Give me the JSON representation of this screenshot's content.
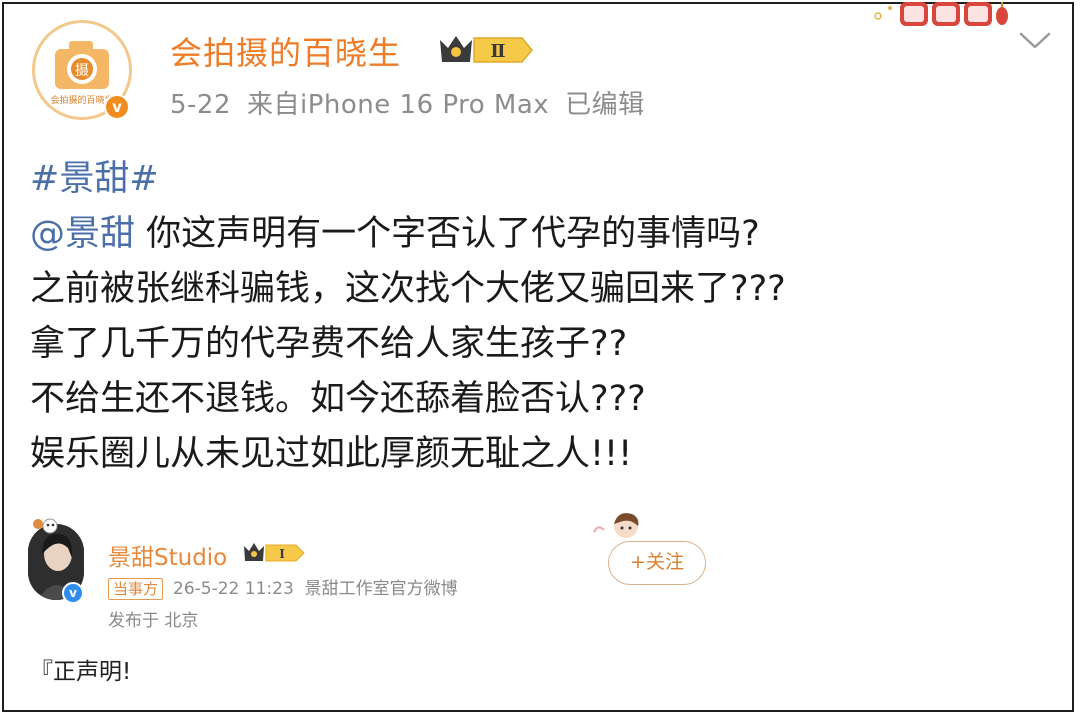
{
  "post": {
    "author": {
      "name": "会拍摄的百晓生",
      "avatar_text": "会拍摄的百晓生",
      "badge_level": "Ⅱ"
    },
    "meta": {
      "date": "5-22",
      "source": "来自iPhone 16 Pro Max",
      "edited": "已编辑"
    },
    "topic": "#景甜#",
    "mention": "@景甜",
    "lines": [
      "你这声明有一个字否认了代孕的事情吗?",
      "之前被张继科骗钱，这次找个大佬又骗回来了???",
      "拿了几千万的代孕费不给人家生孩子??",
      "不给生还不退钱。如今还舔着脸否认???",
      "娱乐圈儿从未见过如此厚颜无耻之人!!!"
    ],
    "icons": [
      "chevron-down-icon",
      "verified-icon",
      "crown-badge-icon"
    ]
  },
  "embedded_card": {
    "name": "景甜Studio",
    "badge_level": "Ⅰ",
    "tag": "当事方",
    "timestamp": "26-5-22 11:23",
    "source": "景甜工作室官方微博",
    "location": "发布于 北京",
    "follow_label": "+关注",
    "statement_preview": "『正声明!"
  },
  "colors": {
    "accent_orange": "#ee7b26",
    "link_blue": "#4b6fa8",
    "meta_gray": "#8c8c8c"
  }
}
